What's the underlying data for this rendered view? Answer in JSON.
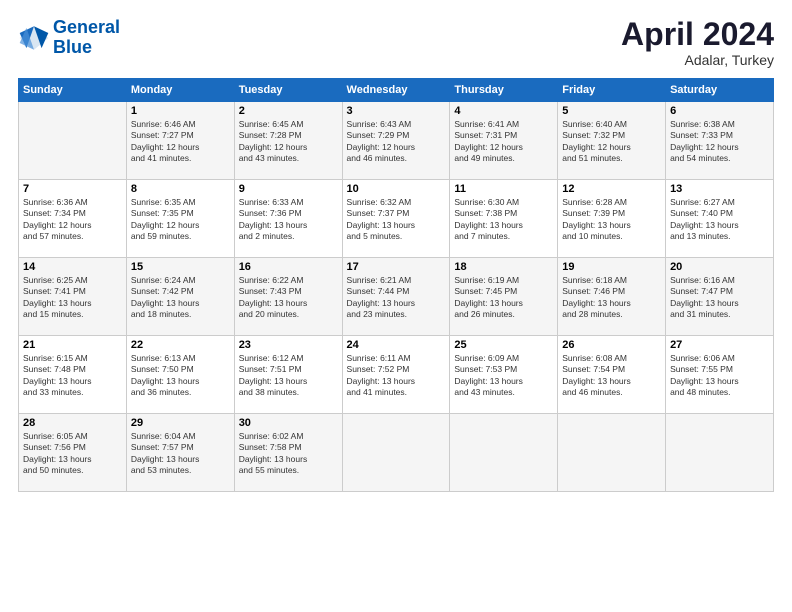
{
  "header": {
    "logo_line1": "General",
    "logo_line2": "Blue",
    "month": "April 2024",
    "location": "Adalar, Turkey"
  },
  "weekdays": [
    "Sunday",
    "Monday",
    "Tuesday",
    "Wednesday",
    "Thursday",
    "Friday",
    "Saturday"
  ],
  "weeks": [
    [
      {
        "day": "",
        "info": ""
      },
      {
        "day": "1",
        "info": "Sunrise: 6:46 AM\nSunset: 7:27 PM\nDaylight: 12 hours\nand 41 minutes."
      },
      {
        "day": "2",
        "info": "Sunrise: 6:45 AM\nSunset: 7:28 PM\nDaylight: 12 hours\nand 43 minutes."
      },
      {
        "day": "3",
        "info": "Sunrise: 6:43 AM\nSunset: 7:29 PM\nDaylight: 12 hours\nand 46 minutes."
      },
      {
        "day": "4",
        "info": "Sunrise: 6:41 AM\nSunset: 7:31 PM\nDaylight: 12 hours\nand 49 minutes."
      },
      {
        "day": "5",
        "info": "Sunrise: 6:40 AM\nSunset: 7:32 PM\nDaylight: 12 hours\nand 51 minutes."
      },
      {
        "day": "6",
        "info": "Sunrise: 6:38 AM\nSunset: 7:33 PM\nDaylight: 12 hours\nand 54 minutes."
      }
    ],
    [
      {
        "day": "7",
        "info": "Sunrise: 6:36 AM\nSunset: 7:34 PM\nDaylight: 12 hours\nand 57 minutes."
      },
      {
        "day": "8",
        "info": "Sunrise: 6:35 AM\nSunset: 7:35 PM\nDaylight: 12 hours\nand 59 minutes."
      },
      {
        "day": "9",
        "info": "Sunrise: 6:33 AM\nSunset: 7:36 PM\nDaylight: 13 hours\nand 2 minutes."
      },
      {
        "day": "10",
        "info": "Sunrise: 6:32 AM\nSunset: 7:37 PM\nDaylight: 13 hours\nand 5 minutes."
      },
      {
        "day": "11",
        "info": "Sunrise: 6:30 AM\nSunset: 7:38 PM\nDaylight: 13 hours\nand 7 minutes."
      },
      {
        "day": "12",
        "info": "Sunrise: 6:28 AM\nSunset: 7:39 PM\nDaylight: 13 hours\nand 10 minutes."
      },
      {
        "day": "13",
        "info": "Sunrise: 6:27 AM\nSunset: 7:40 PM\nDaylight: 13 hours\nand 13 minutes."
      }
    ],
    [
      {
        "day": "14",
        "info": "Sunrise: 6:25 AM\nSunset: 7:41 PM\nDaylight: 13 hours\nand 15 minutes."
      },
      {
        "day": "15",
        "info": "Sunrise: 6:24 AM\nSunset: 7:42 PM\nDaylight: 13 hours\nand 18 minutes."
      },
      {
        "day": "16",
        "info": "Sunrise: 6:22 AM\nSunset: 7:43 PM\nDaylight: 13 hours\nand 20 minutes."
      },
      {
        "day": "17",
        "info": "Sunrise: 6:21 AM\nSunset: 7:44 PM\nDaylight: 13 hours\nand 23 minutes."
      },
      {
        "day": "18",
        "info": "Sunrise: 6:19 AM\nSunset: 7:45 PM\nDaylight: 13 hours\nand 26 minutes."
      },
      {
        "day": "19",
        "info": "Sunrise: 6:18 AM\nSunset: 7:46 PM\nDaylight: 13 hours\nand 28 minutes."
      },
      {
        "day": "20",
        "info": "Sunrise: 6:16 AM\nSunset: 7:47 PM\nDaylight: 13 hours\nand 31 minutes."
      }
    ],
    [
      {
        "day": "21",
        "info": "Sunrise: 6:15 AM\nSunset: 7:48 PM\nDaylight: 13 hours\nand 33 minutes."
      },
      {
        "day": "22",
        "info": "Sunrise: 6:13 AM\nSunset: 7:50 PM\nDaylight: 13 hours\nand 36 minutes."
      },
      {
        "day": "23",
        "info": "Sunrise: 6:12 AM\nSunset: 7:51 PM\nDaylight: 13 hours\nand 38 minutes."
      },
      {
        "day": "24",
        "info": "Sunrise: 6:11 AM\nSunset: 7:52 PM\nDaylight: 13 hours\nand 41 minutes."
      },
      {
        "day": "25",
        "info": "Sunrise: 6:09 AM\nSunset: 7:53 PM\nDaylight: 13 hours\nand 43 minutes."
      },
      {
        "day": "26",
        "info": "Sunrise: 6:08 AM\nSunset: 7:54 PM\nDaylight: 13 hours\nand 46 minutes."
      },
      {
        "day": "27",
        "info": "Sunrise: 6:06 AM\nSunset: 7:55 PM\nDaylight: 13 hours\nand 48 minutes."
      }
    ],
    [
      {
        "day": "28",
        "info": "Sunrise: 6:05 AM\nSunset: 7:56 PM\nDaylight: 13 hours\nand 50 minutes."
      },
      {
        "day": "29",
        "info": "Sunrise: 6:04 AM\nSunset: 7:57 PM\nDaylight: 13 hours\nand 53 minutes."
      },
      {
        "day": "30",
        "info": "Sunrise: 6:02 AM\nSunset: 7:58 PM\nDaylight: 13 hours\nand 55 minutes."
      },
      {
        "day": "",
        "info": ""
      },
      {
        "day": "",
        "info": ""
      },
      {
        "day": "",
        "info": ""
      },
      {
        "day": "",
        "info": ""
      }
    ]
  ]
}
